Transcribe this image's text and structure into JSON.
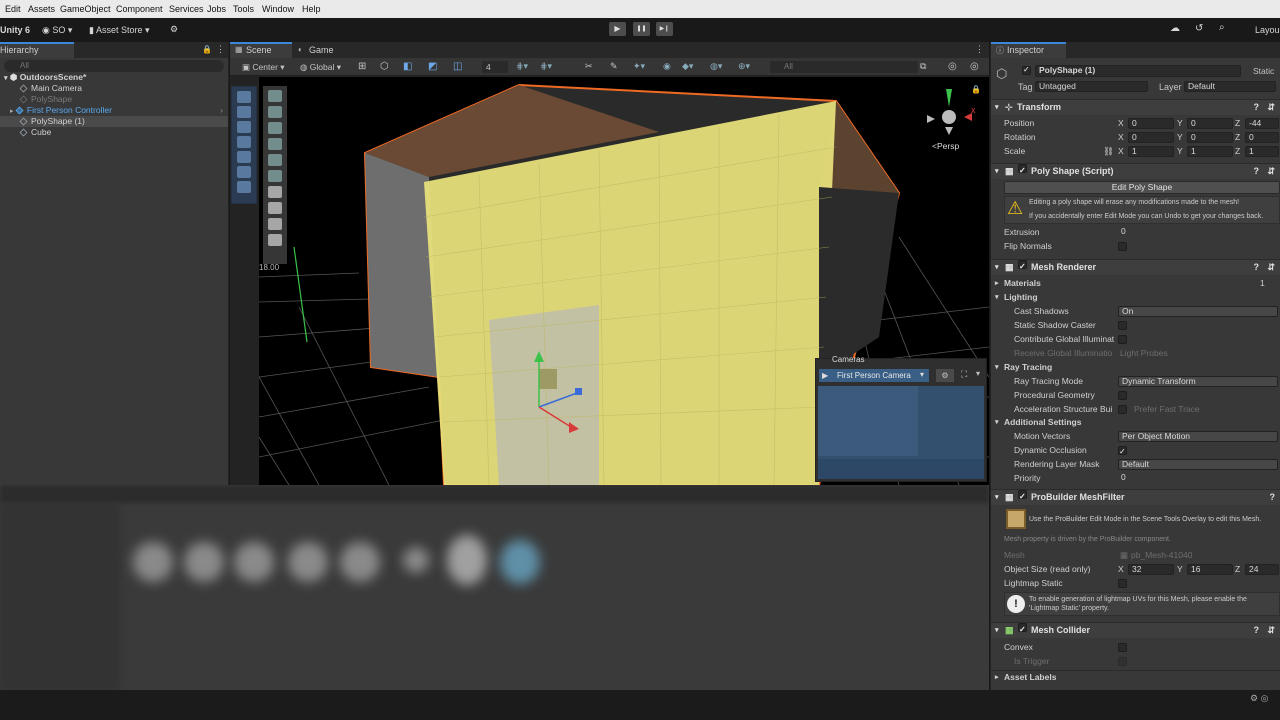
{
  "menu": [
    "Edit",
    "Assets",
    "GameObject",
    "Component",
    "Services",
    "Jobs",
    "Tools",
    "Window",
    "Help"
  ],
  "toolbar": {
    "unity_label": "Unity 6",
    "account": "SO",
    "asset_store": "Asset Store",
    "play": "▶",
    "pause": "❚❚",
    "step": "▶❙",
    "search": "⌕",
    "layout": "Layou"
  },
  "hierarchy": {
    "tab": "Hierarchy",
    "search_placeholder": "All",
    "items": [
      {
        "label": "OutdoorsScene*"
      },
      {
        "label": "Main Camera"
      },
      {
        "label": "PolyShape"
      },
      {
        "label": "First Person Controller"
      },
      {
        "label": "PolyShape (1)"
      },
      {
        "label": "Cube"
      }
    ]
  },
  "scene": {
    "tabs": [
      "Scene",
      "Game"
    ],
    "pivot": "Center",
    "space": "Global",
    "grid_value": "4",
    "search_placeholder": "All",
    "persp_label": "<Persp",
    "ruler_value": "18.00",
    "cameras_overlay": {
      "title": "Cameras",
      "camera": "First Person Camera"
    }
  },
  "inspector": {
    "tab": "Inspector",
    "object_name": "PolyShape (1)",
    "static_label": "Static",
    "tag_label": "Tag",
    "tag_value": "Untagged",
    "layer_label": "Layer",
    "layer_value": "Default",
    "transform": {
      "title": "Transform",
      "rows": [
        {
          "label": "Position",
          "x": "0",
          "y": "0",
          "z": "-44"
        },
        {
          "label": "Rotation",
          "x": "0",
          "y": "0",
          "z": "0"
        },
        {
          "label": "Scale",
          "x": "1",
          "y": "1",
          "z": "1"
        }
      ]
    },
    "polyshape": {
      "title": "Poly Shape (Script)",
      "button": "Edit Poly Shape",
      "warning1": "Editing a poly shape will erase any modifications made to the mesh!",
      "warning2": "If you accidentally enter Edit Mode you can Undo to get your changes back.",
      "extrusion_label": "Extrusion",
      "extrusion_value": "0",
      "flip_label": "Flip Normals"
    },
    "mesh_renderer": {
      "title": "Mesh Renderer",
      "materials_label": "Materials",
      "materials_count": "1",
      "lighting_label": "Lighting",
      "cast_label": "Cast Shadows",
      "cast_value": "On",
      "static_caster": "Static Shadow Caster",
      "contribute_gi": "Contribute Global Illuminat",
      "receive_gi": "Receive Global Illuminatio",
      "receive_gi_value": "Light Probes",
      "raytracing_label": "Ray Tracing",
      "rt_mode_label": "Ray Tracing Mode",
      "rt_mode_value": "Dynamic Transform",
      "procedural": "Procedural Geometry",
      "accel_label": "Acceleration Structure Bui",
      "accel_value": "Prefer Fast Trace",
      "additional_label": "Additional Settings",
      "motion_label": "Motion Vectors",
      "motion_value": "Per Object Motion",
      "occlusion_label": "Dynamic Occlusion",
      "layermask_label": "Rendering Layer Mask",
      "layermask_value": "Default",
      "priority_label": "Priority",
      "priority_value": "0"
    },
    "meshfilter": {
      "title": "ProBuilder MeshFilter",
      "info": "Use the ProBuilder Edit Mode in the Scene Tools Overlay to edit this Mesh.",
      "driven": "Mesh property is driven by the ProBuilder component.",
      "mesh_label": "Mesh",
      "mesh_value": "pb_Mesh-41040",
      "size_label": "Object Size (read only)",
      "size_x": "32",
      "size_y": "16",
      "size_z": "24",
      "lightmap_label": "Lightmap Static",
      "lightmap_info1": "To enable generation of lightmap UVs for this Mesh, please enable the",
      "lightmap_info2": "'Lightmap Static' property."
    },
    "meshcollider": {
      "title": "Mesh Collider",
      "convex": "Convex",
      "trigger": "Is Trigger"
    },
    "asset_labels": "Asset Labels"
  },
  "colors": {
    "accent": "#3d86d8",
    "selection": "#2c5d87",
    "face_yellow": "#e8e27c",
    "edge_orange": "#f06a24"
  }
}
